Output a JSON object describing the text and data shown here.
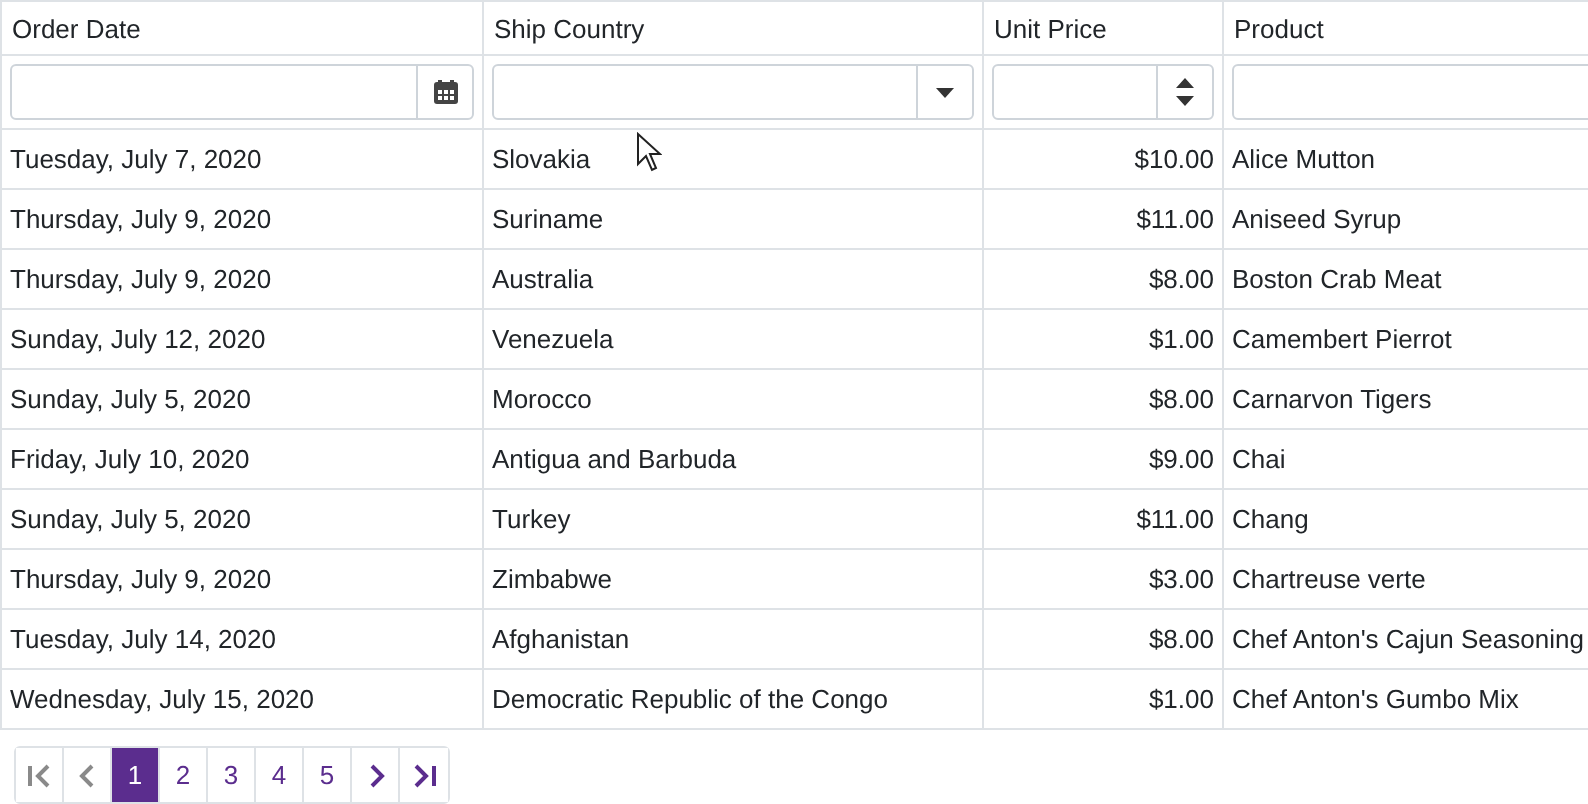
{
  "table": {
    "columns": [
      {
        "title": "Order Date",
        "right_aligned": false,
        "filter": {
          "kind": "date"
        }
      },
      {
        "title": "Ship Country",
        "right_aligned": false,
        "filter": {
          "kind": "dropdown"
        }
      },
      {
        "title": "Unit Price",
        "right_aligned": true,
        "filter": {
          "kind": "numeric"
        }
      },
      {
        "title": "Product",
        "right_aligned": false,
        "filter": {
          "kind": "text"
        }
      }
    ],
    "rows": [
      [
        "Tuesday, July 7, 2020",
        "Slovakia",
        "$10.00",
        "Alice Mutton"
      ],
      [
        "Thursday, July 9, 2020",
        "Suriname",
        "$11.00",
        "Aniseed Syrup"
      ],
      [
        "Thursday, July 9, 2020",
        "Australia",
        "$8.00",
        "Boston Crab Meat"
      ],
      [
        "Sunday, July 12, 2020",
        "Venezuela",
        "$1.00",
        "Camembert Pierrot"
      ],
      [
        "Sunday, July 5, 2020",
        "Morocco",
        "$8.00",
        "Carnarvon Tigers"
      ],
      [
        "Friday, July 10, 2020",
        "Antigua and Barbuda",
        "$9.00",
        "Chai"
      ],
      [
        "Sunday, July 5, 2020",
        "Turkey",
        "$11.00",
        "Chang"
      ],
      [
        "Thursday, July 9, 2020",
        "Zimbabwe",
        "$3.00",
        "Chartreuse verte"
      ],
      [
        "Tuesday, July 14, 2020",
        "Afghanistan",
        "$8.00",
        "Chef Anton's Cajun Seasoning"
      ],
      [
        "Wednesday, July 15, 2020",
        "Democratic Republic of the Congo",
        "$1.00",
        "Chef Anton's Gumbo Mix"
      ]
    ]
  },
  "pager": {
    "nav_before": [
      {
        "kind": "first",
        "disabled": true
      },
      {
        "kind": "prev",
        "disabled": true
      }
    ],
    "pages": [
      {
        "label": "1",
        "selected": true
      },
      {
        "label": "2",
        "selected": false
      },
      {
        "label": "3",
        "selected": false
      },
      {
        "label": "4",
        "selected": false
      },
      {
        "label": "5",
        "selected": false
      }
    ],
    "nav_after": [
      {
        "kind": "next",
        "disabled": false
      },
      {
        "kind": "last",
        "disabled": false
      }
    ]
  }
}
